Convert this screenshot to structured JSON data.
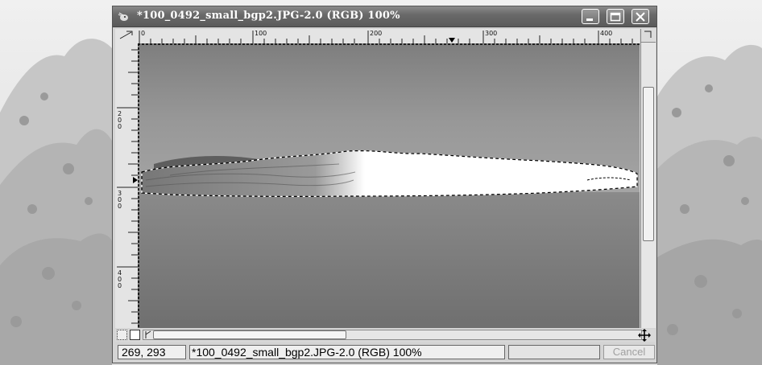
{
  "window": {
    "title": "*100_0492_small_bgp2.JPG-2.0 (RGB) 100%",
    "controls": {
      "minimize_icon": "minimize-icon",
      "maximize_icon": "maximize-icon",
      "close_icon": "close-icon"
    }
  },
  "rulers": {
    "horizontal_labels": [
      "0",
      "100",
      "200",
      "300",
      "400"
    ],
    "vertical_labels": [
      "2 0 0",
      "3 0 0",
      "4 0 0"
    ]
  },
  "status": {
    "coordinates": "269, 293",
    "message": "*100_0492_small_bgp2.JPG-2.0 (RGB) 100%",
    "cancel_label": "Cancel"
  },
  "colors": {
    "titlebar": "#6a6a6a",
    "sky": "#8a8a8a",
    "water": "#7c7c7c",
    "selection": "#ffffff"
  }
}
